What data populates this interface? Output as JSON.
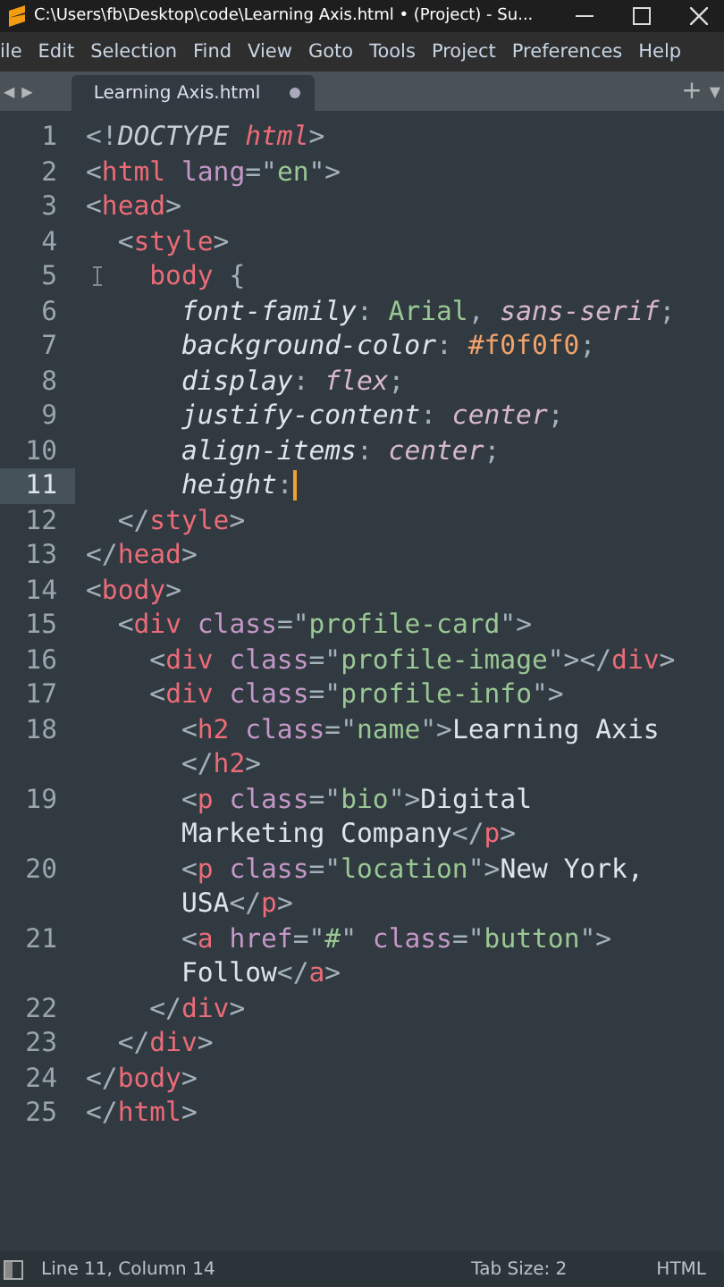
{
  "window": {
    "title": "C:\\Users\\fb\\Desktop\\code\\Learning Axis.html • (Project) - Su..."
  },
  "menu": [
    "ile",
    "Edit",
    "Selection",
    "Find",
    "View",
    "Goto",
    "Tools",
    "Project",
    "Preferences",
    "Help"
  ],
  "tab_bar": {
    "back": "◀",
    "forward": "▶",
    "add": "+",
    "more": "▼"
  },
  "tabs": [
    {
      "label": "Learning Axis.html",
      "selected": true,
      "modified": true
    }
  ],
  "lines": [
    {
      "number": "1",
      "current": false,
      "rows": [
        {
          "tokens": [
            {
              "text": "<!",
              "kind": "p"
            },
            {
              "text": "DOCTYPE",
              "kind": "doct"
            },
            {
              "text": " html",
              "kind": "tagi"
            },
            {
              "text": ">",
              "kind": "p"
            }
          ]
        }
      ]
    },
    {
      "number": "2",
      "current": false,
      "rows": [
        {
          "tokens": [
            {
              "text": "<",
              "kind": "p"
            },
            {
              "text": "html",
              "kind": "tag"
            },
            {
              "text": " lang",
              "kind": "attr"
            },
            {
              "text": "=\"",
              "kind": "p"
            },
            {
              "text": "en",
              "kind": "str"
            },
            {
              "text": "\">",
              "kind": "p"
            }
          ]
        }
      ]
    },
    {
      "number": "3",
      "current": false,
      "rows": [
        {
          "tokens": [
            {
              "text": "<",
              "kind": "p"
            },
            {
              "text": "head",
              "kind": "tag"
            },
            {
              "text": ">",
              "kind": "p"
            }
          ]
        }
      ]
    },
    {
      "number": "4",
      "current": false,
      "rows": [
        {
          "tokens": [
            {
              "text": "  <",
              "kind": "p"
            },
            {
              "text": "style",
              "kind": "tag"
            },
            {
              "text": ">",
              "kind": "p"
            }
          ]
        }
      ]
    },
    {
      "number": "5",
      "current": false,
      "rows": [
        {
          "tokens": [
            {
              "text": "    body",
              "kind": "tag"
            },
            {
              "text": " {",
              "kind": "p"
            }
          ]
        }
      ]
    },
    {
      "number": "6",
      "current": false,
      "rows": [
        {
          "tokens": [
            {
              "text": "      font-family",
              "kind": "prop"
            },
            {
              "text": ": ",
              "kind": "p"
            },
            {
              "text": "Arial",
              "kind": "str"
            },
            {
              "text": ", ",
              "kind": "p"
            },
            {
              "text": "sans-serif",
              "kind": "kw"
            },
            {
              "text": ";",
              "kind": "p"
            }
          ]
        }
      ]
    },
    {
      "number": "7",
      "current": false,
      "rows": [
        {
          "tokens": [
            {
              "text": "      background-color",
              "kind": "prop"
            },
            {
              "text": ": ",
              "kind": "p"
            },
            {
              "text": "#f0f0f0",
              "kind": "hex"
            },
            {
              "text": ";",
              "kind": "p"
            }
          ]
        }
      ]
    },
    {
      "number": "8",
      "current": false,
      "rows": [
        {
          "tokens": [
            {
              "text": "      display",
              "kind": "prop"
            },
            {
              "text": ": ",
              "kind": "p"
            },
            {
              "text": "flex",
              "kind": "kw"
            },
            {
              "text": ";",
              "kind": "p"
            }
          ]
        }
      ]
    },
    {
      "number": "9",
      "current": false,
      "rows": [
        {
          "tokens": [
            {
              "text": "      justify-content",
              "kind": "prop"
            },
            {
              "text": ": ",
              "kind": "p"
            },
            {
              "text": "center",
              "kind": "kw"
            },
            {
              "text": ";",
              "kind": "p"
            }
          ]
        }
      ]
    },
    {
      "number": "10",
      "current": false,
      "rows": [
        {
          "tokens": [
            {
              "text": "      align-items",
              "kind": "prop"
            },
            {
              "text": ": ",
              "kind": "p"
            },
            {
              "text": "center",
              "kind": "kw"
            },
            {
              "text": ";",
              "kind": "p"
            }
          ]
        }
      ]
    },
    {
      "number": "11",
      "current": true,
      "rows": [
        {
          "tokens": [
            {
              "text": "      height",
              "kind": "prop"
            },
            {
              "text": ":",
              "kind": "p"
            }
          ]
        }
      ]
    },
    {
      "number": "12",
      "current": false,
      "rows": [
        {
          "tokens": [
            {
              "text": "  </",
              "kind": "p"
            },
            {
              "text": "style",
              "kind": "tag"
            },
            {
              "text": ">",
              "kind": "p"
            }
          ]
        }
      ]
    },
    {
      "number": "13",
      "current": false,
      "rows": [
        {
          "tokens": [
            {
              "text": "</",
              "kind": "p"
            },
            {
              "text": "head",
              "kind": "tag"
            },
            {
              "text": ">",
              "kind": "p"
            }
          ]
        }
      ]
    },
    {
      "number": "14",
      "current": false,
      "rows": [
        {
          "tokens": [
            {
              "text": "<",
              "kind": "p"
            },
            {
              "text": "body",
              "kind": "tag"
            },
            {
              "text": ">",
              "kind": "p"
            }
          ]
        }
      ]
    },
    {
      "number": "15",
      "current": false,
      "rows": [
        {
          "tokens": [
            {
              "text": "  <",
              "kind": "p"
            },
            {
              "text": "div",
              "kind": "tag"
            },
            {
              "text": " class",
              "kind": "attr"
            },
            {
              "text": "=\"",
              "kind": "p"
            },
            {
              "text": "profile-card",
              "kind": "str"
            },
            {
              "text": "\">",
              "kind": "p"
            }
          ]
        }
      ]
    },
    {
      "number": "16",
      "current": false,
      "rows": [
        {
          "tokens": [
            {
              "text": "    <",
              "kind": "p"
            },
            {
              "text": "div",
              "kind": "tag"
            },
            {
              "text": " class",
              "kind": "attr"
            },
            {
              "text": "=\"",
              "kind": "p"
            },
            {
              "text": "profile-image",
              "kind": "str"
            },
            {
              "text": "\"></",
              "kind": "p"
            },
            {
              "text": "div",
              "kind": "tag"
            },
            {
              "text": ">",
              "kind": "p"
            }
          ]
        }
      ]
    },
    {
      "number": "17",
      "current": false,
      "rows": [
        {
          "tokens": [
            {
              "text": "    <",
              "kind": "p"
            },
            {
              "text": "div",
              "kind": "tag"
            },
            {
              "text": " class",
              "kind": "attr"
            },
            {
              "text": "=\"",
              "kind": "p"
            },
            {
              "text": "profile-info",
              "kind": "str"
            },
            {
              "text": "\">",
              "kind": "p"
            }
          ]
        }
      ]
    },
    {
      "number": "18",
      "current": false,
      "rows": [
        {
          "tokens": [
            {
              "text": "      <",
              "kind": "p"
            },
            {
              "text": "h2",
              "kind": "tag"
            },
            {
              "text": " class",
              "kind": "attr"
            },
            {
              "text": "=\"",
              "kind": "p"
            },
            {
              "text": "name",
              "kind": "str"
            },
            {
              "text": "\">",
              "kind": "p"
            },
            {
              "text": "Learning Axis",
              "kind": "txt"
            }
          ]
        },
        {
          "tokens": [
            {
              "text": "      </",
              "kind": "p"
            },
            {
              "text": "h2",
              "kind": "tag"
            },
            {
              "text": ">",
              "kind": "p"
            }
          ]
        }
      ]
    },
    {
      "number": "19",
      "current": false,
      "rows": [
        {
          "tokens": [
            {
              "text": "      <",
              "kind": "p"
            },
            {
              "text": "p",
              "kind": "tag"
            },
            {
              "text": " class",
              "kind": "attr"
            },
            {
              "text": "=\"",
              "kind": "p"
            },
            {
              "text": "bio",
              "kind": "str"
            },
            {
              "text": "\">",
              "kind": "p"
            },
            {
              "text": "Digital",
              "kind": "txt"
            }
          ]
        },
        {
          "tokens": [
            {
              "text": "      Marketing Company",
              "kind": "txt"
            },
            {
              "text": "</",
              "kind": "p"
            },
            {
              "text": "p",
              "kind": "tag"
            },
            {
              "text": ">",
              "kind": "p"
            }
          ]
        }
      ]
    },
    {
      "number": "20",
      "current": false,
      "rows": [
        {
          "tokens": [
            {
              "text": "      <",
              "kind": "p"
            },
            {
              "text": "p",
              "kind": "tag"
            },
            {
              "text": " class",
              "kind": "attr"
            },
            {
              "text": "=\"",
              "kind": "p"
            },
            {
              "text": "location",
              "kind": "str"
            },
            {
              "text": "\">",
              "kind": "p"
            },
            {
              "text": "New York,",
              "kind": "txt"
            }
          ]
        },
        {
          "tokens": [
            {
              "text": "      USA",
              "kind": "txt"
            },
            {
              "text": "</",
              "kind": "p"
            },
            {
              "text": "p",
              "kind": "tag"
            },
            {
              "text": ">",
              "kind": "p"
            }
          ]
        }
      ]
    },
    {
      "number": "21",
      "current": false,
      "rows": [
        {
          "tokens": [
            {
              "text": "      <",
              "kind": "p"
            },
            {
              "text": "a",
              "kind": "tag"
            },
            {
              "text": " href",
              "kind": "attr"
            },
            {
              "text": "=\"",
              "kind": "p"
            },
            {
              "text": "#",
              "kind": "str"
            },
            {
              "text": "\"",
              "kind": "p"
            },
            {
              "text": " class",
              "kind": "attr"
            },
            {
              "text": "=\"",
              "kind": "p"
            },
            {
              "text": "button",
              "kind": "str"
            },
            {
              "text": "\">",
              "kind": "p"
            }
          ]
        },
        {
          "tokens": [
            {
              "text": "      Follow",
              "kind": "txt"
            },
            {
              "text": "</",
              "kind": "p"
            },
            {
              "text": "a",
              "kind": "tag"
            },
            {
              "text": ">",
              "kind": "p"
            }
          ]
        }
      ]
    },
    {
      "number": "22",
      "current": false,
      "rows": [
        {
          "tokens": [
            {
              "text": "    </",
              "kind": "p"
            },
            {
              "text": "div",
              "kind": "tag"
            },
            {
              "text": ">",
              "kind": "p"
            }
          ]
        }
      ]
    },
    {
      "number": "23",
      "current": false,
      "rows": [
        {
          "tokens": [
            {
              "text": "  </",
              "kind": "p"
            },
            {
              "text": "div",
              "kind": "tag"
            },
            {
              "text": ">",
              "kind": "p"
            }
          ]
        }
      ]
    },
    {
      "number": "24",
      "current": false,
      "rows": [
        {
          "tokens": [
            {
              "text": "</",
              "kind": "p"
            },
            {
              "text": "body",
              "kind": "tag"
            },
            {
              "text": ">",
              "kind": "p"
            }
          ]
        }
      ]
    },
    {
      "number": "25",
      "current": false,
      "rows": [
        {
          "tokens": [
            {
              "text": "</",
              "kind": "p"
            },
            {
              "text": "html",
              "kind": "tag"
            },
            {
              "text": ">",
              "kind": "p"
            }
          ]
        }
      ]
    }
  ],
  "status_bar": {
    "position": "Line 11, Column 14",
    "tab_size": "Tab Size: 2",
    "syntax": "HTML"
  }
}
